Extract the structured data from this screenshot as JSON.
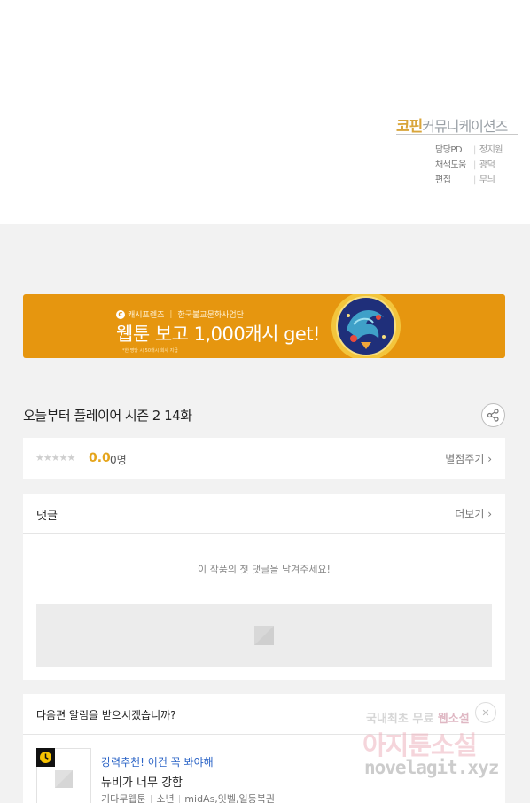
{
  "credits": {
    "brand_highlight": "코핀",
    "brand_rest": "커뮤니케이션즈",
    "rows": [
      {
        "role": "담당PD",
        "name": "정지원"
      },
      {
        "role": "채색도움",
        "name": "광덕"
      },
      {
        "role": "편집",
        "name": "무늬"
      }
    ]
  },
  "banner": {
    "sub_brand": "캐시프렌즈",
    "sub_partner": "한국불교문화사업단",
    "title": "웹툰 보고 1,000캐시 get!",
    "fine_print": "*한 명당 시 50캐시 회사 지급",
    "accent": "#e6960f"
  },
  "episode": {
    "title": "오늘부터 플레이어 시즌 2 14화",
    "share_icon": "share-icon"
  },
  "rating": {
    "stars": "★★★★★",
    "score": "0.0",
    "count": "0명",
    "rate_link": "별점주기 ›"
  },
  "comments": {
    "title": "댓글",
    "more": "더보기 ›",
    "empty_message": "이 작품의 첫 댓글을 남겨주세요!"
  },
  "notify": {
    "question": "다음편 알림을 받으시겠습니까?",
    "close": "✕",
    "recommend_tag": "강력추천! 이건 꼭 봐야해",
    "recommend_title": "뉴비가 너무 강함",
    "recommend_genre": "기다무웹툰",
    "recommend_category": "소년",
    "recommend_authors": "midAs,잇벨,일등복권"
  },
  "watermark": {
    "line1_a": "국내최초 무료",
    "line1_b": "웹소설",
    "line2": "아지툰소설",
    "line3": "novelagit.xyz"
  }
}
